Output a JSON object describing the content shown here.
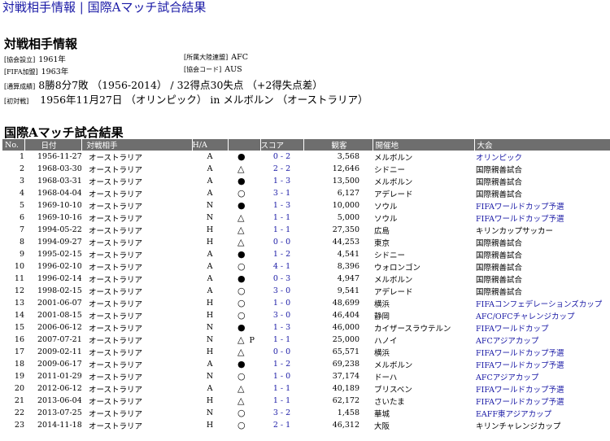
{
  "page_title": "対戦相手情報 | 国際Aマッチ試合結果",
  "info": {
    "heading": "対戦相手情報",
    "founded_label": "[協会設立]",
    "founded_value": "1961年",
    "fifa_label": "[FIFA加盟]",
    "fifa_value": "1963年",
    "confed_label": "[所属大陸連盟]",
    "confed_value": "AFC",
    "code_label": "[協会コード]",
    "code_value": "AUS",
    "record_label": "[通算成績]",
    "record_value": "8勝8分7敗 （1956-2014） / 32得点30失点 （+2得失点差）",
    "first_label": "[初対戦]",
    "first_value": "1956年11月27日 （オリンピック） in メルボルン （オーストラリア）"
  },
  "results": {
    "heading": "国際Aマッチ試合結果",
    "columns": [
      "No.",
      "日付",
      "対戦相手",
      "H/A",
      "",
      "スコア",
      "観客",
      "開催地",
      "大会"
    ],
    "rows": [
      {
        "no": "1",
        "date": "1956-11-27",
        "team": "オーストラリア",
        "ha": "A",
        "res": "●",
        "pk": "",
        "score": "0 - 2",
        "att": "3,568",
        "venue": "メルボルン",
        "comp": "オリンピック",
        "link": true
      },
      {
        "no": "2",
        "date": "1968-03-30",
        "team": "オーストラリア",
        "ha": "A",
        "res": "△",
        "pk": "",
        "score": "2 - 2",
        "att": "12,646",
        "venue": "シドニー",
        "comp": "国際親善試合",
        "link": false
      },
      {
        "no": "3",
        "date": "1968-03-31",
        "team": "オーストラリア",
        "ha": "A",
        "res": "●",
        "pk": "",
        "score": "1 - 3",
        "att": "13,500",
        "venue": "メルボルン",
        "comp": "国際親善試合",
        "link": false
      },
      {
        "no": "4",
        "date": "1968-04-04",
        "team": "オーストラリア",
        "ha": "A",
        "res": "○",
        "pk": "",
        "score": "3 - 1",
        "att": "6,127",
        "venue": "アデレード",
        "comp": "国際親善試合",
        "link": false
      },
      {
        "no": "5",
        "date": "1969-10-10",
        "team": "オーストラリア",
        "ha": "N",
        "res": "●",
        "pk": "",
        "score": "1 - 3",
        "att": "10,000",
        "venue": "ソウル",
        "comp": "FIFAワールドカップ予選",
        "link": true
      },
      {
        "no": "6",
        "date": "1969-10-16",
        "team": "オーストラリア",
        "ha": "N",
        "res": "△",
        "pk": "",
        "score": "1 - 1",
        "att": "5,000",
        "venue": "ソウル",
        "comp": "FIFAワールドカップ予選",
        "link": true
      },
      {
        "no": "7",
        "date": "1994-05-22",
        "team": "オーストラリア",
        "ha": "H",
        "res": "△",
        "pk": "",
        "score": "1 - 1",
        "att": "27,350",
        "venue": "広島",
        "comp": "キリンカップサッカー",
        "link": false
      },
      {
        "no": "8",
        "date": "1994-09-27",
        "team": "オーストラリア",
        "ha": "H",
        "res": "△",
        "pk": "",
        "score": "0 - 0",
        "att": "44,253",
        "venue": "東京",
        "comp": "国際親善試合",
        "link": false
      },
      {
        "no": "9",
        "date": "1995-02-15",
        "team": "オーストラリア",
        "ha": "A",
        "res": "●",
        "pk": "",
        "score": "1 - 2",
        "att": "4,541",
        "venue": "シドニー",
        "comp": "国際親善試合",
        "link": false
      },
      {
        "no": "10",
        "date": "1996-02-10",
        "team": "オーストラリア",
        "ha": "A",
        "res": "○",
        "pk": "",
        "score": "4 - 1",
        "att": "8,396",
        "venue": "ウォロンゴン",
        "comp": "国際親善試合",
        "link": false
      },
      {
        "no": "11",
        "date": "1996-02-14",
        "team": "オーストラリア",
        "ha": "A",
        "res": "●",
        "pk": "",
        "score": "0 - 3",
        "att": "4,947",
        "venue": "メルボルン",
        "comp": "国際親善試合",
        "link": false
      },
      {
        "no": "12",
        "date": "1998-02-15",
        "team": "オーストラリア",
        "ha": "A",
        "res": "○",
        "pk": "",
        "score": "3 - 0",
        "att": "9,541",
        "venue": "アデレード",
        "comp": "国際親善試合",
        "link": false
      },
      {
        "no": "13",
        "date": "2001-06-07",
        "team": "オーストラリア",
        "ha": "H",
        "res": "○",
        "pk": "",
        "score": "1 - 0",
        "att": "48,699",
        "venue": "横浜",
        "comp": "FIFAコンフェデレーションズカップ",
        "link": true
      },
      {
        "no": "14",
        "date": "2001-08-15",
        "team": "オーストラリア",
        "ha": "H",
        "res": "○",
        "pk": "",
        "score": "3 - 0",
        "att": "46,404",
        "venue": "静岡",
        "comp": "AFC/OFCチャレンジカップ",
        "link": true
      },
      {
        "no": "15",
        "date": "2006-06-12",
        "team": "オーストラリア",
        "ha": "N",
        "res": "●",
        "pk": "",
        "score": "1 - 3",
        "att": "46,000",
        "venue": "カイザースラウテルン",
        "comp": "FIFAワールドカップ",
        "link": true
      },
      {
        "no": "16",
        "date": "2007-07-21",
        "team": "オーストラリア",
        "ha": "N",
        "res": "△",
        "pk": "P",
        "score": "1 - 1",
        "att": "25,000",
        "venue": "ハノイ",
        "comp": "AFCアジアカップ",
        "link": true
      },
      {
        "no": "17",
        "date": "2009-02-11",
        "team": "オーストラリア",
        "ha": "H",
        "res": "△",
        "pk": "",
        "score": "0 - 0",
        "att": "65,571",
        "venue": "横浜",
        "comp": "FIFAワールドカップ予選",
        "link": true
      },
      {
        "no": "18",
        "date": "2009-06-17",
        "team": "オーストラリア",
        "ha": "A",
        "res": "●",
        "pk": "",
        "score": "1 - 2",
        "att": "69,238",
        "venue": "メルボルン",
        "comp": "FIFAワールドカップ予選",
        "link": true
      },
      {
        "no": "19",
        "date": "2011-01-29",
        "team": "オーストラリア",
        "ha": "N",
        "res": "○",
        "pk": "",
        "score": "1 - 0",
        "att": "37,174",
        "venue": "ドーハ",
        "comp": "AFCアジアカップ",
        "link": true
      },
      {
        "no": "20",
        "date": "2012-06-12",
        "team": "オーストラリア",
        "ha": "A",
        "res": "△",
        "pk": "",
        "score": "1 - 1",
        "att": "40,189",
        "venue": "ブリスベン",
        "comp": "FIFAワールドカップ予選",
        "link": true
      },
      {
        "no": "21",
        "date": "2013-06-04",
        "team": "オーストラリア",
        "ha": "H",
        "res": "△",
        "pk": "",
        "score": "1 - 1",
        "att": "62,172",
        "venue": "さいたま",
        "comp": "FIFAワールドカップ予選",
        "link": true
      },
      {
        "no": "22",
        "date": "2013-07-25",
        "team": "オーストラリア",
        "ha": "N",
        "res": "○",
        "pk": "",
        "score": "3 - 2",
        "att": "1,458",
        "venue": "華城",
        "comp": "EAFF東アジアカップ",
        "link": true
      },
      {
        "no": "23",
        "date": "2014-11-18",
        "team": "オーストラリア",
        "ha": "H",
        "res": "○",
        "pk": "",
        "score": "2 - 1",
        "att": "46,312",
        "venue": "大阪",
        "comp": "キリンチャレンジカップ",
        "link": false
      }
    ]
  }
}
